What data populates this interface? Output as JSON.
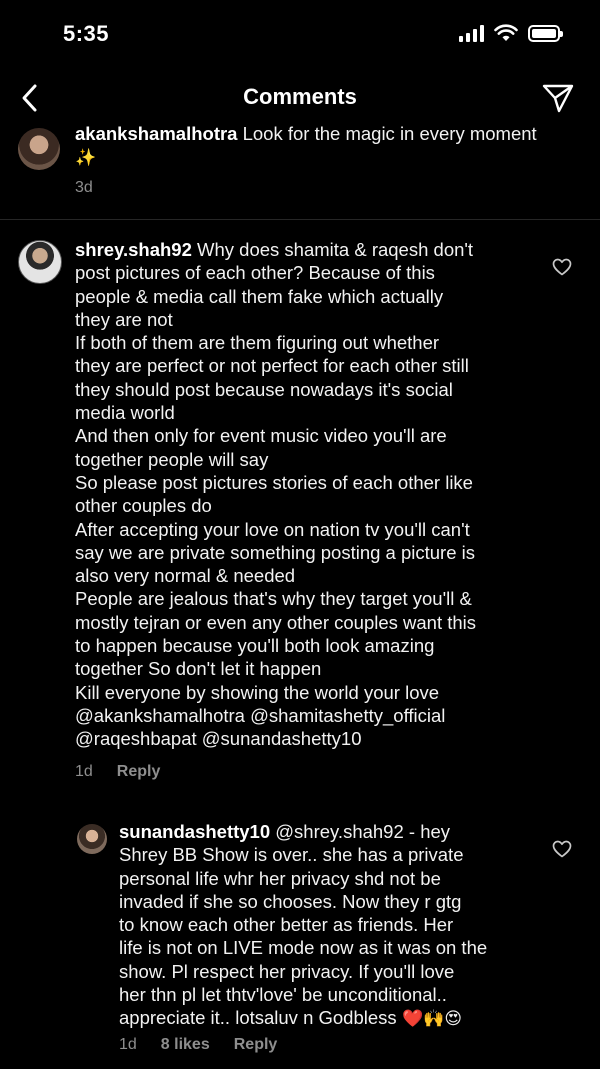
{
  "status": {
    "time": "5:35"
  },
  "nav": {
    "title": "Comments"
  },
  "comments": [
    {
      "username": "akankshamalhotra",
      "text": " Look for the magic in every moment",
      "emoji": "✨",
      "time": "3d"
    },
    {
      "username": "shrey.shah92",
      "lines": [
        " Why does shamita & raqesh don't",
        "post pictures of each other? Because of this",
        "people & media call them fake which actually",
        "they are not",
        "If both of them are them figuring out whether",
        "they are perfect or not perfect for each other still",
        "they should post because nowadays it's social",
        "media world",
        "And then only for event music video you'll are",
        "together people will say",
        "So please post pictures stories of each other like",
        "other couples do",
        "After accepting your love on nation tv you'll can't",
        "say we are private something posting a picture is",
        "also very normal & needed",
        "People are jealous that's why they target you'll &",
        "mostly tejran or even any other couples want this",
        "to happen because you'll both look amazing",
        "together So don't let it happen",
        "Kill everyone by showing the world your love",
        "@akankshamalhotra @shamitashetty_official",
        "@raqeshbapat @sunandashetty10"
      ],
      "time": "1d",
      "reply": "Reply"
    },
    {
      "username": "sunandashetty10",
      "lines": [
        " @shrey.shah92 - hey",
        "Shrey BB Show is over.. she has a private",
        "personal life whr her privacy shd not be",
        "invaded if she so chooses.  Now they r  gtg",
        "to know each other better as friends. Her",
        "life is not on LIVE mode now as it was on the",
        "show. Pl respect her privacy. If you'll love",
        "her thn pl let thtv'love' be unconditional..",
        "appreciate it.. lotsaluv n Godbless"
      ],
      "emoji": " ❤️🙌😍",
      "time": "1d",
      "likes": "8 likes",
      "reply": "Reply"
    }
  ]
}
